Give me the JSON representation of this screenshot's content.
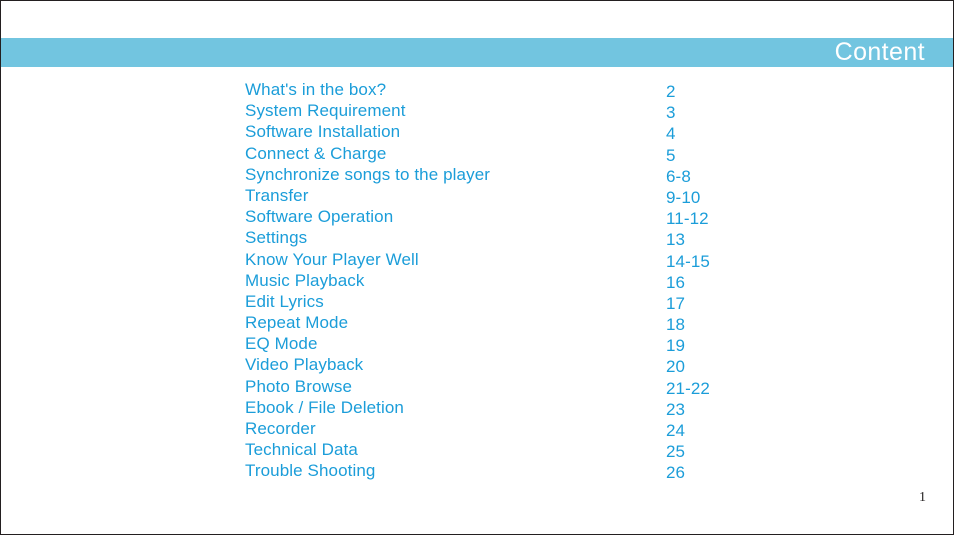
{
  "document": {
    "header": {
      "title": "Content",
      "bar_color": "#72c5e0",
      "title_color": "#ffffff"
    },
    "body_text_color": "#1b9dd9",
    "page_footer": {
      "page_number": "1"
    },
    "toc": [
      {
        "label": "What's in the box?",
        "pages": "2"
      },
      {
        "label": "System Requirement",
        "pages": "3"
      },
      {
        "label": "Software Installation",
        "pages": "4"
      },
      {
        "label": "Connect & Charge",
        "pages": "5"
      },
      {
        "label": "Synchronize songs to the player",
        "pages": "6-8"
      },
      {
        "label": "Transfer",
        "pages": "9-10"
      },
      {
        "label": "Software Operation",
        "pages": "11-12"
      },
      {
        "label": "Settings",
        "pages": "13"
      },
      {
        "label": "Know Your Player Well",
        "pages": "14-15"
      },
      {
        "label": "Music Playback",
        "pages": "16"
      },
      {
        "label": "Edit Lyrics",
        "pages": "17"
      },
      {
        "label": "Repeat Mode",
        "pages": "18"
      },
      {
        "label": "EQ Mode",
        "pages": "19"
      },
      {
        "label": "Video Playback",
        "pages": "20"
      },
      {
        "label": "Photo Browse",
        "pages": "21-22"
      },
      {
        "label": "Ebook / File Deletion",
        "pages": "23"
      },
      {
        "label": "Recorder",
        "pages": "24"
      },
      {
        "label": "Technical Data",
        "pages": "25"
      },
      {
        "label": "Trouble Shooting",
        "pages": "26"
      }
    ]
  }
}
